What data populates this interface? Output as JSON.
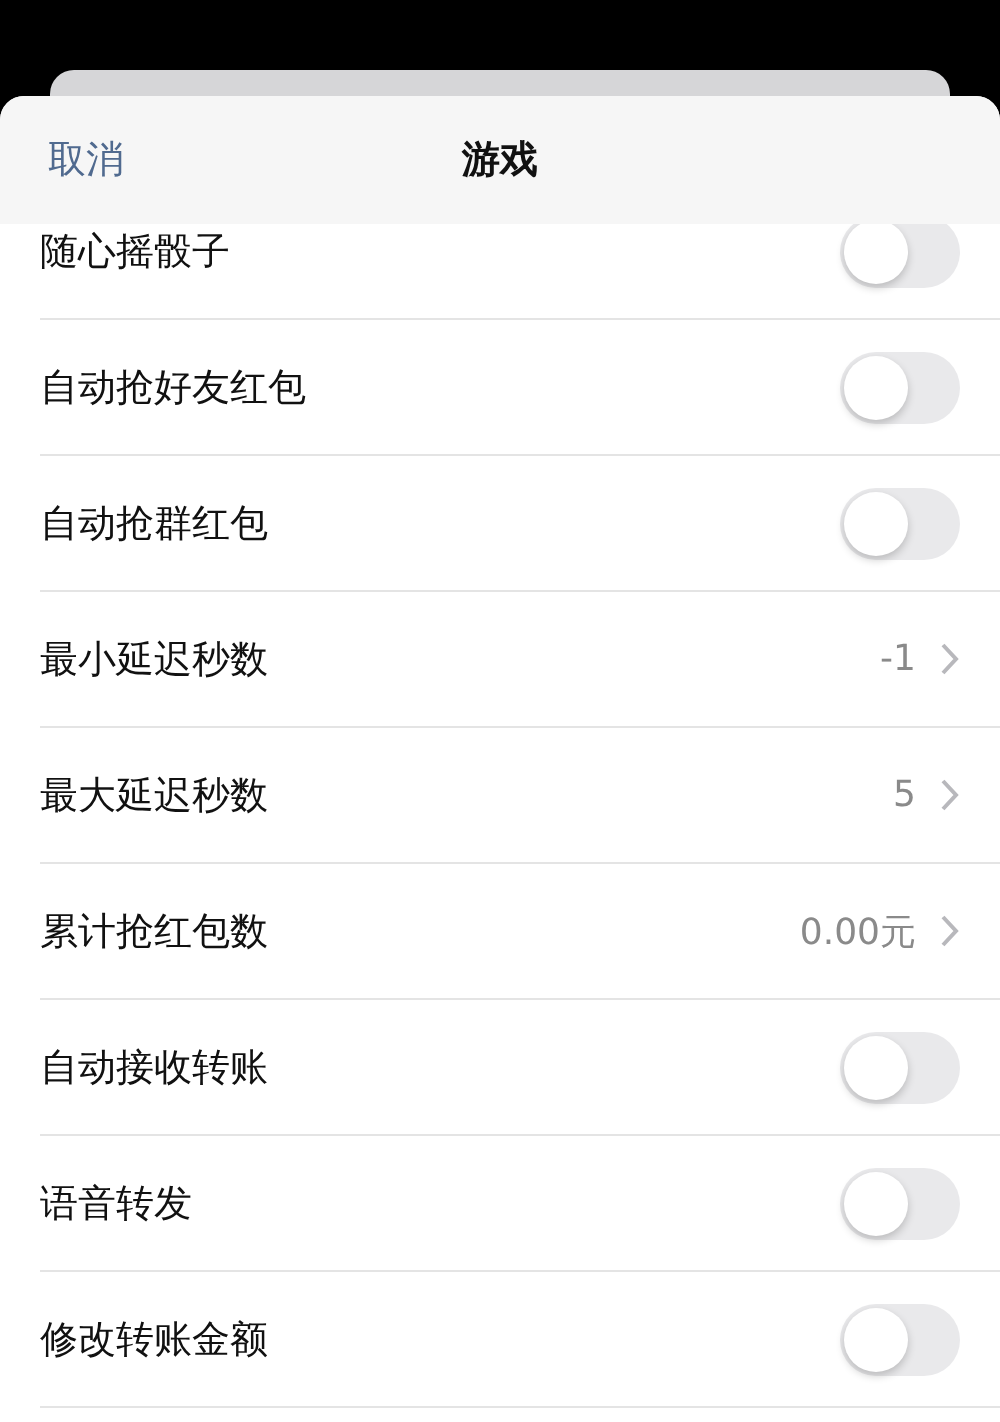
{
  "header": {
    "cancel": "取消",
    "title": "游戏"
  },
  "rows": [
    {
      "kind": "toggle",
      "label": "随心摇骰子",
      "on": false
    },
    {
      "kind": "toggle",
      "label": "自动抢好友红包",
      "on": false
    },
    {
      "kind": "toggle",
      "label": "自动抢群红包",
      "on": false
    },
    {
      "kind": "value",
      "label": "最小延迟秒数",
      "value": "-1"
    },
    {
      "kind": "value",
      "label": "最大延迟秒数",
      "value": "5"
    },
    {
      "kind": "value",
      "label": "累计抢红包数",
      "value": "0.00元"
    },
    {
      "kind": "toggle",
      "label": "自动接收转账",
      "on": false
    },
    {
      "kind": "toggle",
      "label": "语音转发",
      "on": false
    },
    {
      "kind": "toggle",
      "label": "修改转账金额",
      "on": false
    }
  ]
}
